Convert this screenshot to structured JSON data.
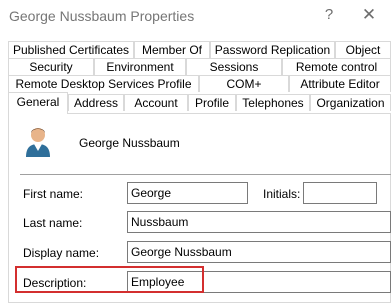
{
  "window": {
    "title": "George Nussbaum Properties",
    "help_symbol": "?",
    "close_symbol": "✕"
  },
  "tabs": {
    "row1": [
      "Published Certificates",
      "Member Of",
      "Password Replication",
      "Object"
    ],
    "row2": [
      "Security",
      "Environment",
      "Sessions",
      "Remote control"
    ],
    "row3": [
      "Remote Desktop Services Profile",
      "COM+",
      "Attribute Editor"
    ],
    "row4": [
      "General",
      "Address",
      "Account",
      "Profile",
      "Telephones",
      "Organization"
    ],
    "active": "General"
  },
  "general": {
    "display_name_header": "George Nussbaum",
    "first_name_label": "First name:",
    "first_name_value": "George",
    "initials_label": "Initials:",
    "initials_value": "",
    "last_name_label": "Last name:",
    "last_name_value": "Nussbaum",
    "display_name_label": "Display name:",
    "display_name_value": "George Nussbaum",
    "description_label": "Description:",
    "description_value": "Employee"
  },
  "colors": {
    "highlight": "#d32f2f"
  },
  "icons": {
    "user": "user-icon"
  }
}
